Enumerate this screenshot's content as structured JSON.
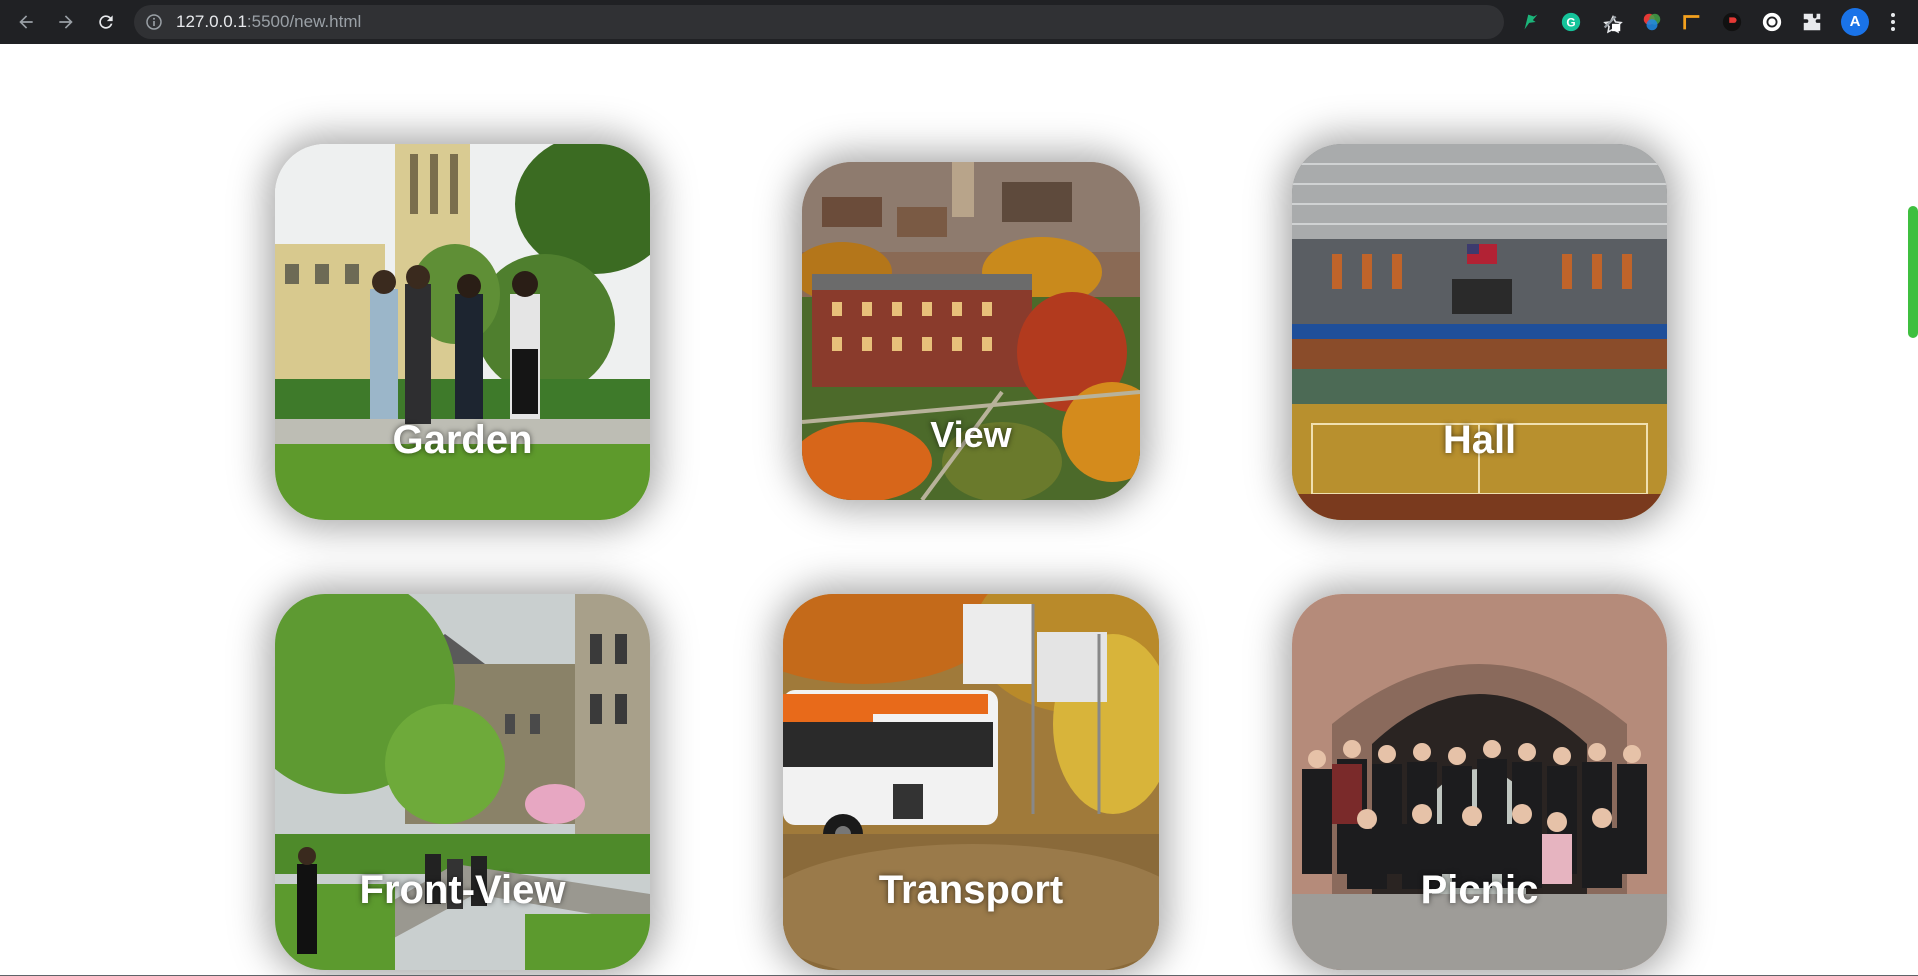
{
  "browser": {
    "url_host": "127.0.0.1",
    "url_path": ":5500/new.html",
    "avatar_letter": "A",
    "icons": [
      "back-icon",
      "forward-icon",
      "reload-icon",
      "info-icon",
      "star-icon",
      "extensions-icon",
      "menu-icon"
    ]
  },
  "gallery": {
    "cards": [
      {
        "label": "Garden"
      },
      {
        "label": "View"
      },
      {
        "label": "Hall"
      },
      {
        "label": "Front-View"
      },
      {
        "label": "Transport"
      },
      {
        "label": "Picnic"
      }
    ]
  },
  "colors": {
    "chrome_bg": "#202124",
    "omnibox_bg": "#303134",
    "scrollbar_thumb": "#3fbf3f",
    "label_text": "#ffffff"
  }
}
